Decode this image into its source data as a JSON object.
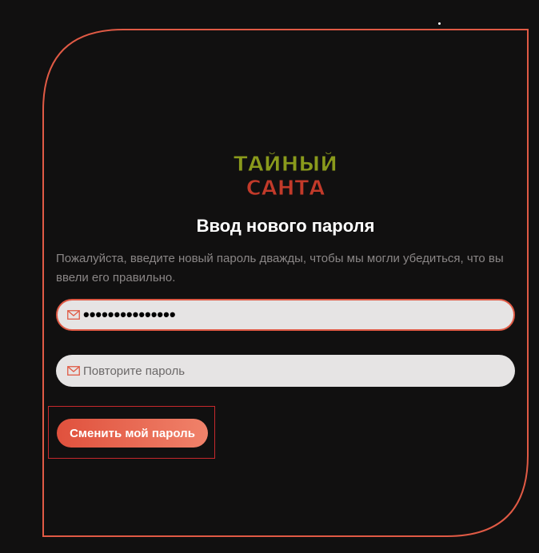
{
  "logo": {
    "line1": "ТАЙНЫЙ",
    "line2": "САНТА",
    "colors": [
      "#8a9a1c",
      "#c23a2a",
      "#2e7d2e",
      "#e6c229"
    ]
  },
  "form": {
    "title": "Ввод нового пароля",
    "description": "Пожалуйста, введите новый пароль дважды, чтобы мы могли убедиться, что вы ввели его правильно.",
    "password_field": {
      "value": "•••••••••••••••",
      "icon": "envelope-icon"
    },
    "confirm_field": {
      "value": "",
      "placeholder": "Повторите пароль",
      "icon": "envelope-icon"
    },
    "submit_label": "Сменить мой пароль"
  },
  "colors": {
    "background": "#111010",
    "accent": "#e05a45",
    "field_bg": "#e6e4e4",
    "text_muted": "#8a8686"
  }
}
